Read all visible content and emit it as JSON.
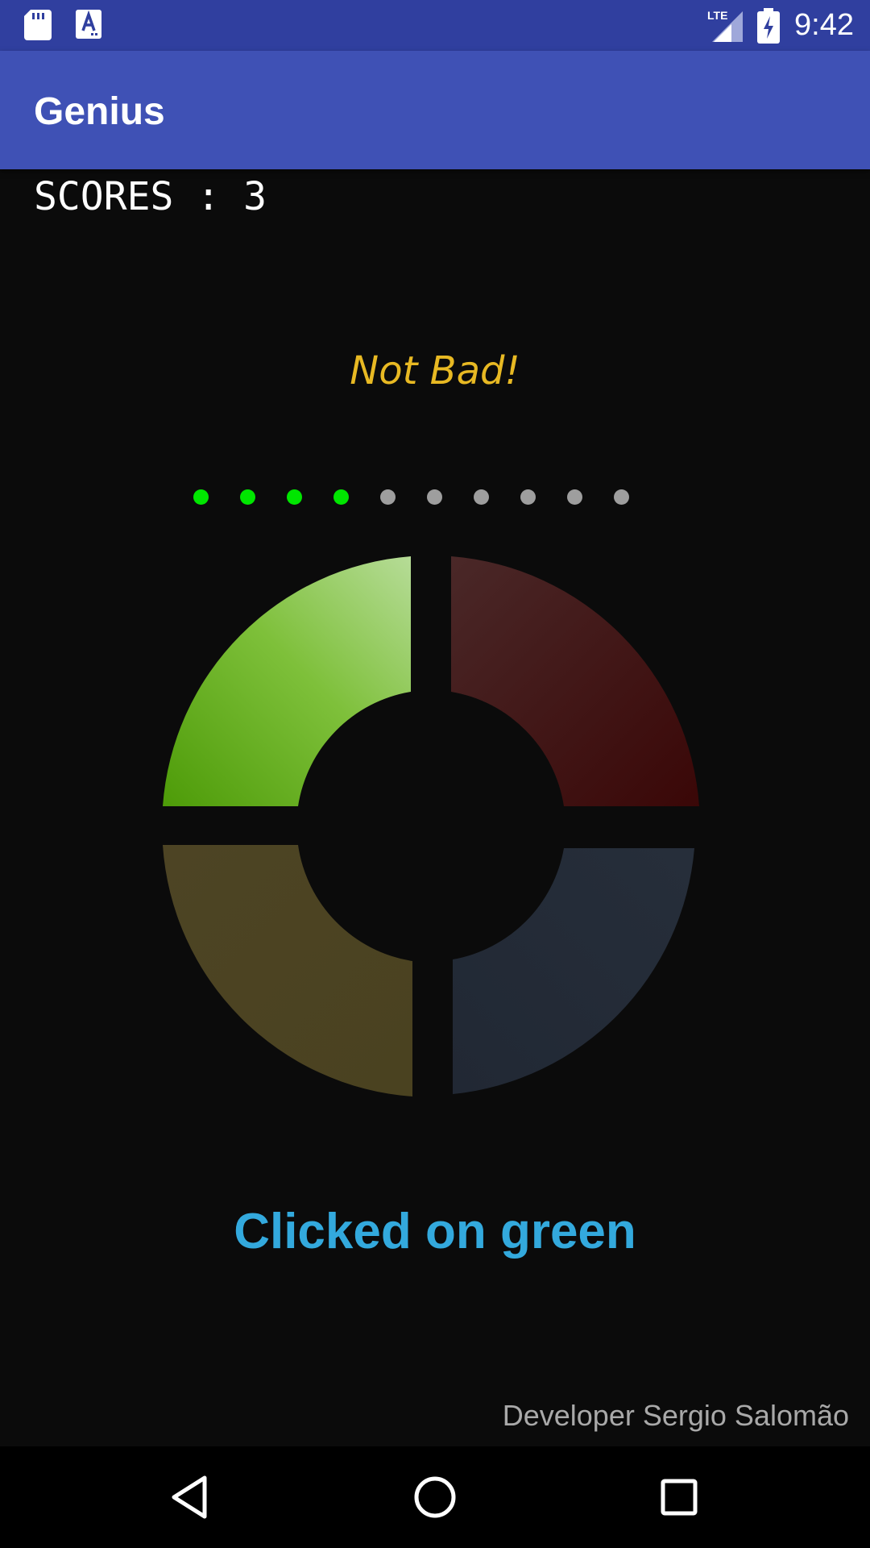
{
  "status_bar": {
    "time": "9:42",
    "network": "LTE",
    "icons": [
      "sd-card-icon",
      "a-notification-icon",
      "lte-signal-icon",
      "battery-charging-icon"
    ]
  },
  "app_bar": {
    "title": "Genius"
  },
  "score": {
    "text": "SCORES : 3"
  },
  "feedback": {
    "text": "Not Bad!"
  },
  "sequence_progress": {
    "completed": 4,
    "total": 10,
    "colors": {
      "done": "#00e600",
      "pending": "#9e9e9e"
    }
  },
  "game_board": {
    "pads": [
      {
        "name": "green",
        "state": "lit",
        "color": "#4fa30a"
      },
      {
        "name": "red",
        "state": "dim",
        "color": "#3a0a0a"
      },
      {
        "name": "yellow",
        "state": "dim",
        "color": "#4a4222"
      },
      {
        "name": "blue",
        "state": "dim",
        "color": "#242b37"
      }
    ]
  },
  "status_message": {
    "text": "Clicked on green"
  },
  "credit": {
    "text": "Developer Sergio Salomão"
  },
  "nav_bar": {
    "buttons": [
      "back-icon",
      "home-icon",
      "recents-icon"
    ]
  },
  "colors": {
    "status_bar": "#303f9f",
    "app_bar": "#3f51b5",
    "background": "#0b0b0b",
    "feedback": "#e8b923",
    "status_message": "#33a9dd"
  }
}
